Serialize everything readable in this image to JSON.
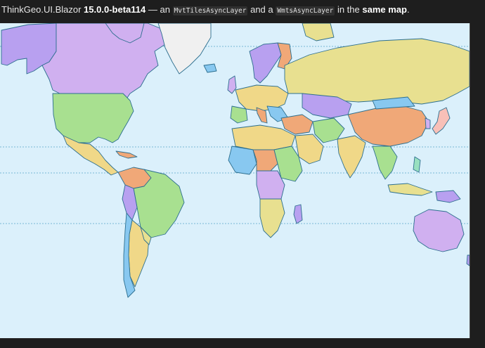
{
  "caption": {
    "prefix": "ThinkGeo.UI.Blazor ",
    "version": "15.0.0-beta114",
    "mid1": " — an ",
    "layer1": "MvtTilesAsyncLayer",
    "mid2": " and a ",
    "layer2": "WmtsAsyncLayer",
    "mid3": " in the ",
    "emphasis": "same map",
    "suffix": "."
  },
  "map": {
    "ocean_color": "#dbf0fb",
    "coast_color": "#2d6f8f",
    "graticule_color": "#5aa6c8",
    "palette": [
      "#b8a0f0",
      "#f0d888",
      "#a8e090",
      "#f0a878",
      "#88c8f0",
      "#d0b0f0",
      "#e8e090",
      "#f8c0b8",
      "#98e0c0",
      "#c8e088"
    ]
  }
}
